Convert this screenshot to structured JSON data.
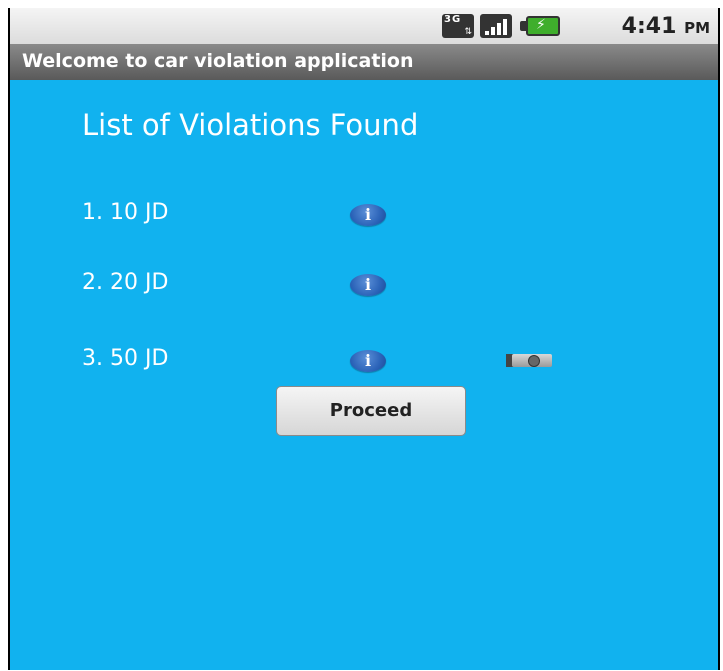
{
  "status_bar": {
    "network_type_label": "3G",
    "network_icon": "3g-data-icon",
    "signal_icon": "signal-strength-icon",
    "battery_icon": "battery-charging-icon",
    "time": "4:41",
    "ampm": "PM"
  },
  "title_bar": {
    "title": "Welcome to car violation application"
  },
  "main": {
    "heading": "List of Violations Found",
    "violations": [
      {
        "label": "1. 10 JD",
        "info_icon": "info-icon",
        "info_glyph": "i"
      },
      {
        "label": "2. 20 JD",
        "info_icon": "info-icon",
        "info_glyph": "i"
      },
      {
        "label": "3. 50 JD",
        "info_icon": "info-icon",
        "info_glyph": "i",
        "camera_icon": "camera-icon"
      }
    ],
    "proceed_label": "Proceed"
  },
  "colors": {
    "background": "#11b2ef",
    "title_bar": "#6e6e6e",
    "status_bar": "#e6e6e6",
    "info_icon": "#2b63b8",
    "text": "#ffffff"
  }
}
